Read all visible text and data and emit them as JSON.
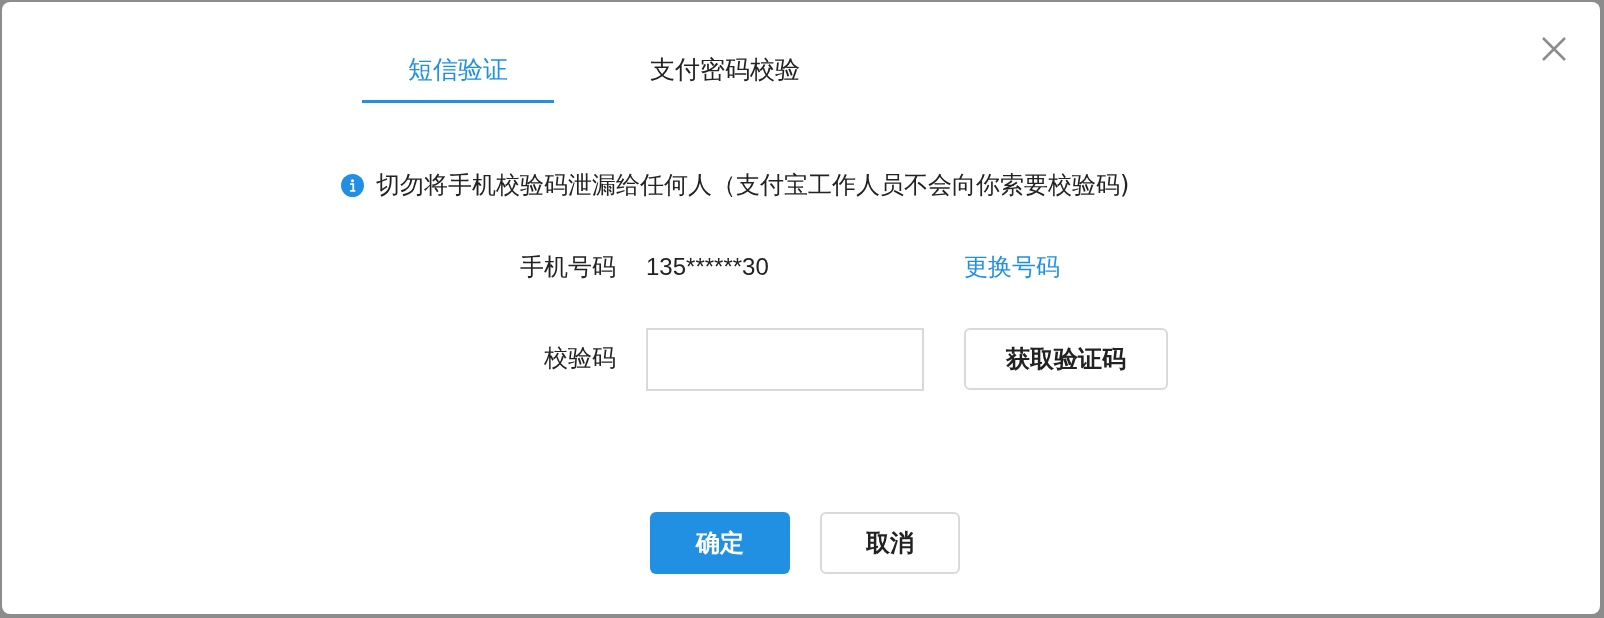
{
  "tabs": [
    {
      "label": "短信验证",
      "selected": true
    },
    {
      "label": "支付密码校验",
      "selected": false
    }
  ],
  "notice": "切勿将手机校验码泄漏给任何人（支付宝工作人员不会向你索要校验码)",
  "phone": {
    "label": "手机号码",
    "value": "135******30",
    "link": "更换号码"
  },
  "code": {
    "label": "校验码",
    "button": "获取验证码"
  },
  "buttons": [
    {
      "label": "确定",
      "kind": "primary"
    },
    {
      "label": "取消",
      "kind": "default"
    }
  ]
}
